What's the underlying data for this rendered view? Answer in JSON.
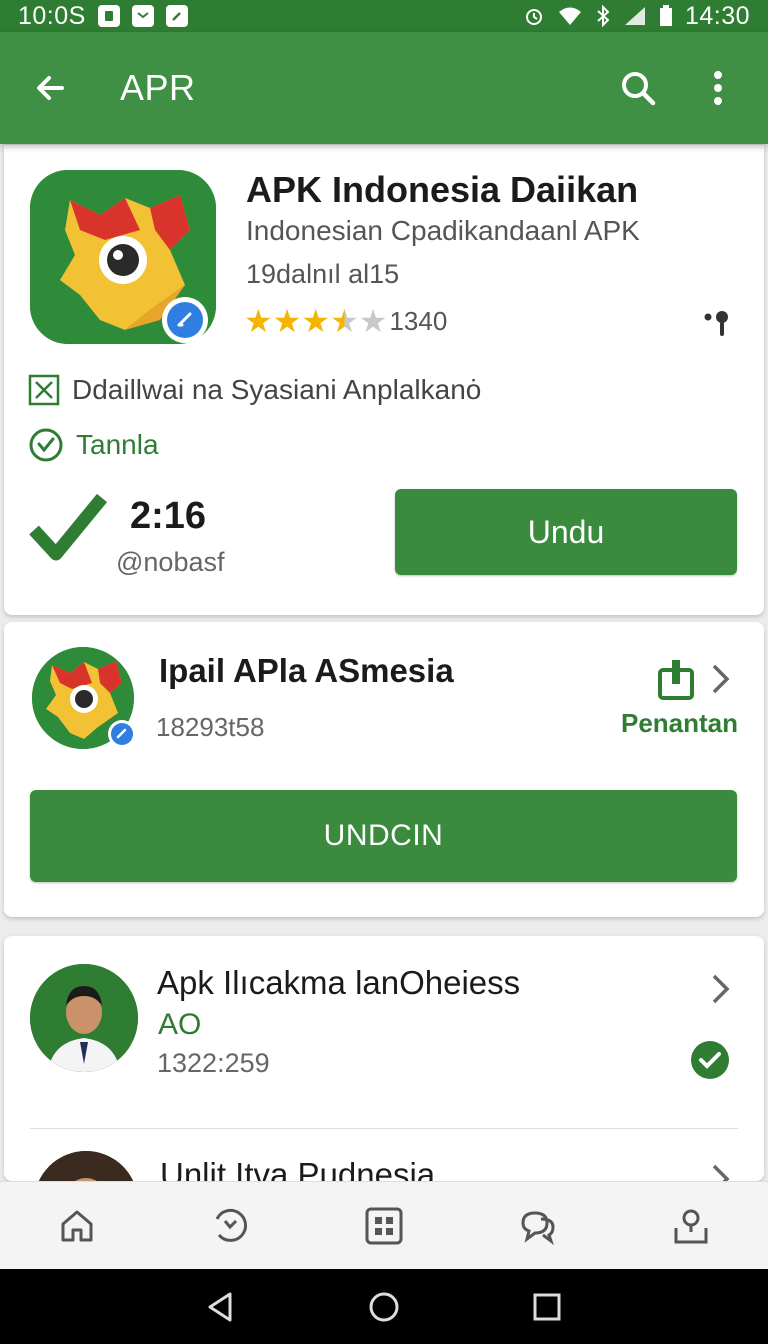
{
  "status_bar": {
    "left_time": "10:0S",
    "right_time": "14:30",
    "notification_icons": [
      "app-icon",
      "message-icon",
      "edit-icon"
    ],
    "system_icons": [
      "alarm-icon",
      "wifi-icon",
      "bluetooth-icon",
      "signal-icon",
      "battery-icon"
    ]
  },
  "app_bar": {
    "title": "APR",
    "background": "#3f8f45"
  },
  "featured_app": {
    "title": "APK Indonesia Daiikan",
    "subtitle": "Indonesian Cpadikandaanl APK",
    "size": "19dalnıl al15",
    "rating": 3.5,
    "rating_count": "1340",
    "feature_1": "Ddaillwai na Syasiani Anplalkanȯ",
    "feature_2": "Tannla",
    "version": "2:16",
    "developer": "@nobasf",
    "button": "Undu"
  },
  "second_app": {
    "title": "Ipail APla ASmesia",
    "meta": "18293t58",
    "link": "Penantan",
    "button": "UNDCIN"
  },
  "third_app": {
    "title": "Apk Ilıcakma lanOheiess",
    "subtitle": "AO",
    "meta": "1322:259"
  },
  "fourth_app": {
    "title": "Unlit Itva Pudnesia"
  },
  "bottom_nav": [
    "home-icon",
    "history-icon",
    "apps-icon",
    "chat-icon",
    "profile-icon"
  ],
  "colors": {
    "primary": "#3f8f45",
    "primary_dark": "#2e7d32",
    "star": "#f5b400",
    "badge": "#2f7ee0"
  }
}
